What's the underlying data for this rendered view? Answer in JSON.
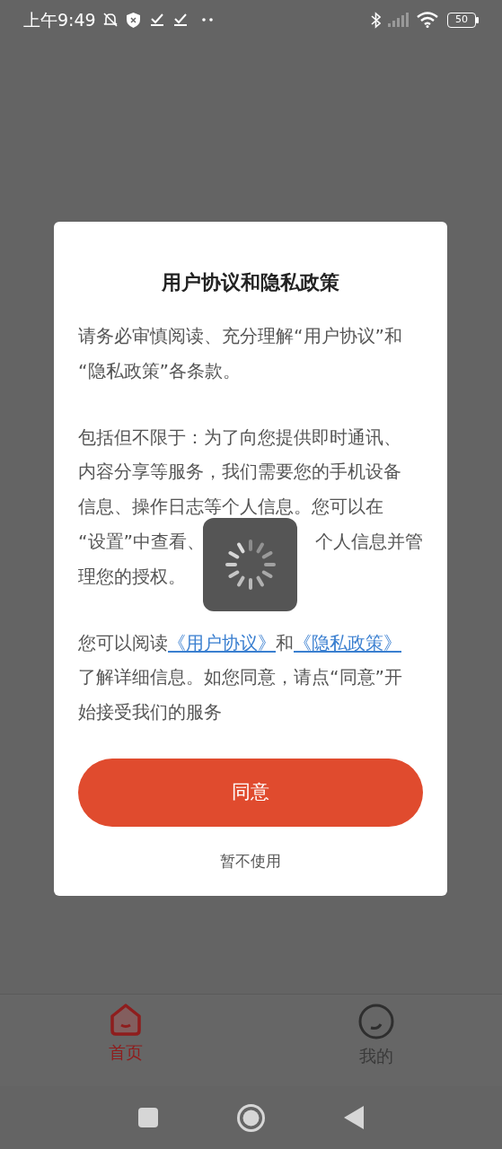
{
  "status_bar": {
    "time": "上午9:49",
    "battery": "50"
  },
  "dialog": {
    "title": "用户协议和隐私政策",
    "paragraphs": [
      [
        {
          "kind": "plain",
          "segments": [
            {
              "kind": "text",
              "text": "请务必审慎阅读、充分理解“用户协议”和"
            }
          ]
        },
        {
          "kind": "plain",
          "segments": [
            {
              "kind": "text",
              "text": "“隐私政策”各条款。"
            }
          ]
        }
      ],
      [
        {
          "kind": "plain",
          "segments": [
            {
              "kind": "text",
              "text": "包括但不限于：为了向您提供即时通讯、"
            }
          ]
        },
        {
          "kind": "plain",
          "segments": [
            {
              "kind": "text",
              "text": "内容分享等服务，我们需要您的手机设备"
            }
          ]
        },
        {
          "kind": "plain",
          "segments": [
            {
              "kind": "text",
              "text": "信息、操作日志等个人信息。您可以在"
            }
          ]
        },
        {
          "kind": "split",
          "segments": [
            {
              "kind": "text",
              "text": "“设置”中查看、"
            },
            {
              "kind": "text",
              "text": "个人信息并管"
            }
          ]
        },
        {
          "kind": "plain",
          "segments": [
            {
              "kind": "text",
              "text": "理您的授权。"
            }
          ]
        }
      ],
      [
        {
          "kind": "plain",
          "segments": [
            {
              "kind": "text",
              "text": "您可以阅读"
            },
            {
              "kind": "link",
              "text": "《用户协议》"
            },
            {
              "kind": "text",
              "text": "和"
            },
            {
              "kind": "link",
              "text": "《隐私政策》"
            }
          ]
        },
        {
          "kind": "plain",
          "segments": [
            {
              "kind": "text",
              "text": "了解详细信息。如您同意，请点“同意”开"
            }
          ]
        },
        {
          "kind": "plain",
          "segments": [
            {
              "kind": "text",
              "text": "始接受我们的服务"
            }
          ]
        }
      ]
    ],
    "agree_button": "同意",
    "decline_link": "暂不使用"
  },
  "tabs": [
    {
      "label": "首页",
      "selected": true,
      "kind": "home"
    },
    {
      "label": "我的",
      "selected": false,
      "kind": "mine"
    }
  ]
}
